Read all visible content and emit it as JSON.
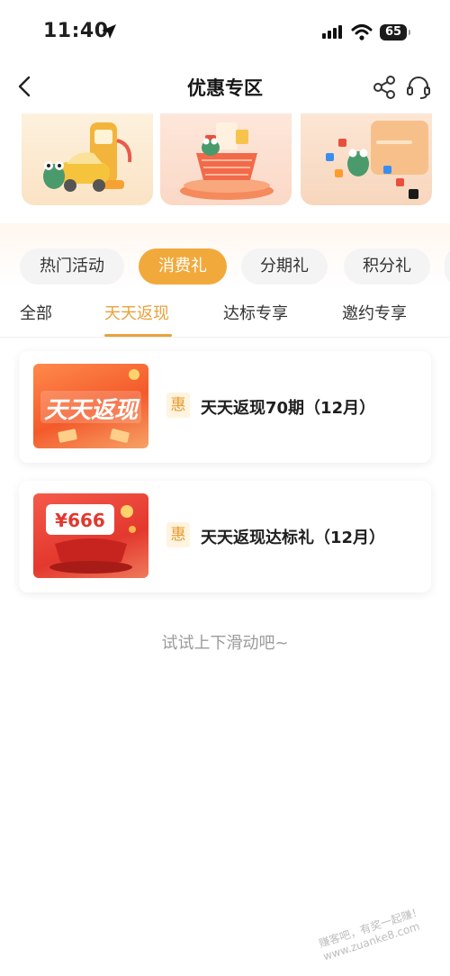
{
  "status": {
    "time": "11:40",
    "battery": "65"
  },
  "nav": {
    "title": "优惠专区"
  },
  "categories": [
    "热门活动",
    "消费礼",
    "分期礼",
    "积分礼"
  ],
  "active_category": "消费礼",
  "subtabs": [
    "全部",
    "天天返现",
    "达标专享",
    "邀约专享"
  ],
  "active_subtab": "天天返现",
  "offers": [
    {
      "tag": "惠",
      "title": "天天返现70期（12月）",
      "thumb_text": "天天返现"
    },
    {
      "tag": "惠",
      "title": "天天返现达标礼（12月）",
      "thumb_text": "¥666"
    }
  ],
  "hint": "试试上下滑动吧~",
  "watermark": "赚客吧，有奖一起赚！www.zuanke8.com",
  "colors": {
    "accent": "#f2a93b",
    "active_text": "#e8a23b",
    "tag_bg": "#fff4df"
  }
}
